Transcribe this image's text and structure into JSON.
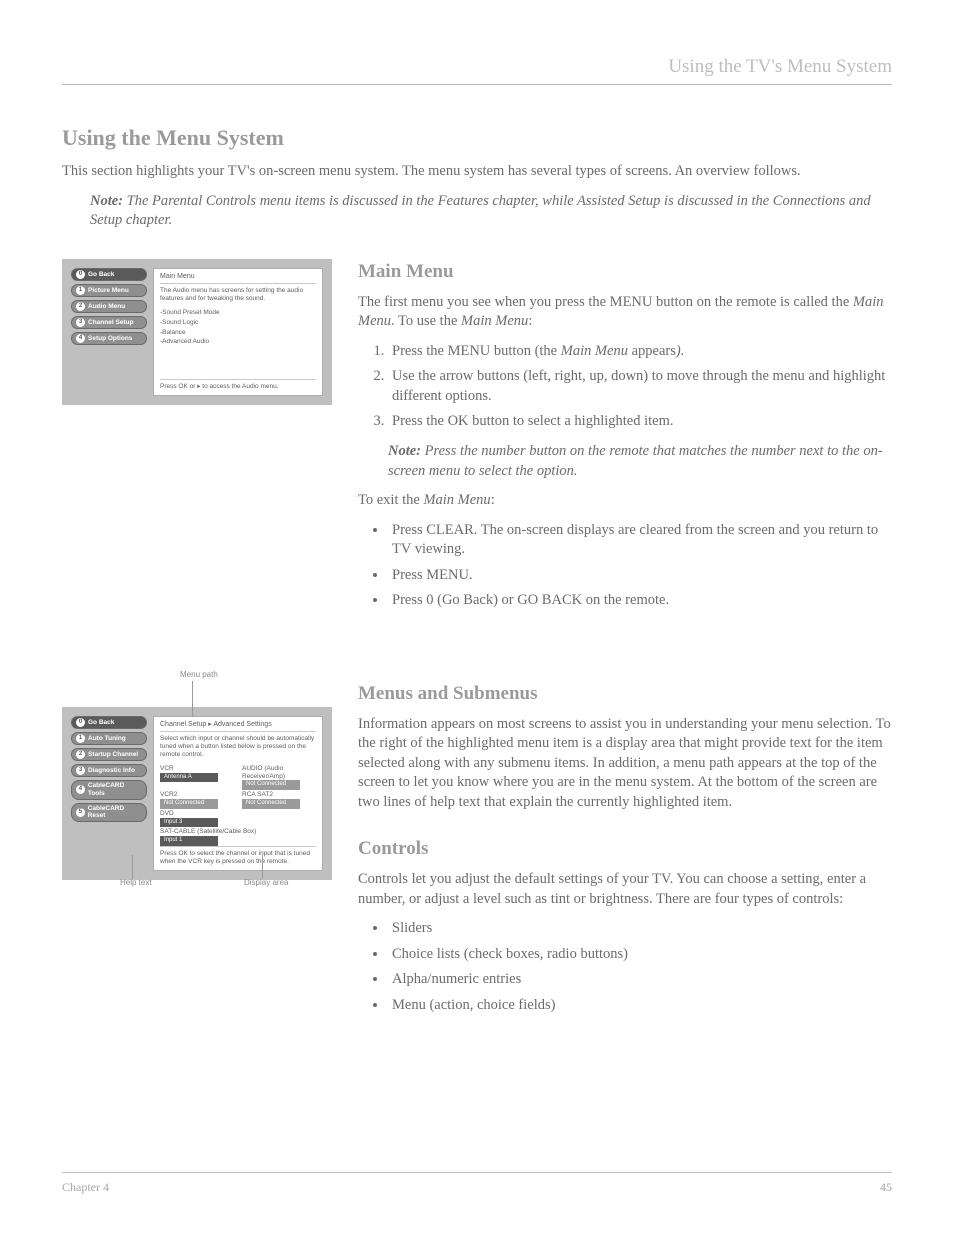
{
  "chapter_head": "Using the TV's Menu System",
  "intro_title": "Using the Menu System",
  "intro_body": "This section highlights your TV's on-screen menu system. The menu system has several types of screens. An overview follows.",
  "note_label": "Note:",
  "intro_note": " The Parental Controls menu items is discussed in the Features chapter, while Assisted Setup is discussed in the Connections and Setup chapter.",
  "tv1": {
    "title": "Main Menu",
    "desc": "The Audio menu has screens for setting the audio features and for tweaking the sound.",
    "sidebar": [
      {
        "n": "0",
        "label": "Go Back",
        "sel": true
      },
      {
        "n": "1",
        "label": "Picture Menu"
      },
      {
        "n": "2",
        "label": "Audio Menu"
      },
      {
        "n": "3",
        "label": "Channel Setup"
      },
      {
        "n": "4",
        "label": "Setup Options"
      }
    ],
    "items": [
      "-Sound Preset Mode",
      "-Sound Logic",
      "-Balance",
      "-Advanced Audio"
    ],
    "footer": "Press OK or ▸ to access the Audio menu."
  },
  "main_menu": {
    "heading": "Main Menu",
    "p1_a": "The first menu you see when you press the MENU button on the remote is called the ",
    "p1_b": "Main Menu",
    "p1_c": ". To use the ",
    "p1_d": "Main Menu",
    "p1_e": ":",
    "step1_a": "Press the MENU button (the ",
    "step1_b": "Main Menu",
    "step1_c": " appears",
    "step1_d": ").",
    "step2": "Use the arrow buttons (left, right, up, down) to move through the menu and highlight different options.",
    "step3": "Press the OK button to select a highlighted item.",
    "inline_note": " Press the number button on the remote that matches the number next to the on-screen menu to select the option.",
    "exit_a": "To exit the ",
    "exit_b": "Main Menu",
    "exit_c": ":",
    "bullet1": "Press CLEAR. The on-screen displays are cleared from the screen and you return to TV viewing.",
    "bullet2": "Press MENU.",
    "bullet3": "Press 0 (Go Back) or GO BACK on the remote."
  },
  "tv2": {
    "path": "Channel Setup ▸ Advanced Settings",
    "desc": "Select which input or channel should be automatically tuned when a button listed below is pressed on the remote control.",
    "sidebar": [
      {
        "n": "0",
        "label": "Go Back",
        "sel": true
      },
      {
        "n": "1",
        "label": "Auto Tuning"
      },
      {
        "n": "2",
        "label": "Startup Channel"
      },
      {
        "n": "3",
        "label": "Diagnostic Info"
      },
      {
        "n": "4",
        "label": "CableCARD Tools"
      },
      {
        "n": "5",
        "label": "CableCARD Reset"
      }
    ],
    "r1l_label": "VCR",
    "r1l_val": "Antenna A",
    "r1l_sel": true,
    "r1r_label": "AUDIO (Audio Receiver/Amp)",
    "r1r_val": "Not Connected",
    "r2l_label": "VCR2",
    "r2l_val": "Not Connected",
    "r2r_label": "RCA SAT2",
    "r2r_val": "Not Connected",
    "r3l_label": "DVD",
    "r3l_val": "Input 3",
    "r4_label": "SAT-CABLE (Satellite/Cable Box)",
    "r4_val": "Input 1",
    "footer": "Press OK to select the channel or input that is tuned when the VCR key is pressed on the remote.",
    "callout_path": "Menu path",
    "callout_help": "Help text",
    "callout_disp": "Display area"
  },
  "menus": {
    "heading": "Menus and Submenus",
    "p": "Information appears on most screens to assist you in understanding your menu selection. To the right of the highlighted menu item is a display area that might provide text for the item selected along with any submenu items. In addition, a menu path appears at the top of the screen to let you know where you are in the menu system. At the bottom of the screen are two lines of help text that explain the currently highlighted item."
  },
  "controls": {
    "heading": "Controls",
    "p": "Controls let you adjust the default settings of your TV. You can choose a setting, enter a number, or adjust a level such as tint or brightness. There are four types of controls:",
    "b1": "Sliders",
    "b2": "Choice lists (check boxes, radio buttons)",
    "b3": "Alpha/numeric entries",
    "b4": "Menu (action, choice fields)"
  },
  "footer_left": "Chapter 4",
  "footer_right": "45"
}
